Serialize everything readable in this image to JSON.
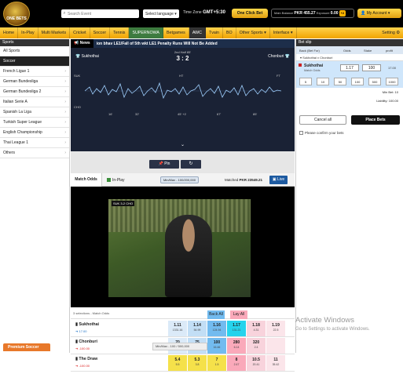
{
  "brand": {
    "logo_text": "ONE BETS"
  },
  "search": {
    "placeholder": "Search Event"
  },
  "language": {
    "label": "Select language ▾"
  },
  "timezone": {
    "label": "Time Zone",
    "value": "GMT+5:30"
  },
  "one_click": {
    "label": "One Click Bet"
  },
  "balance": {
    "main_label": "Main Balance",
    "main_value": "PKR 455.27",
    "exposure_label": "Exposure",
    "exposure_value": "0.00",
    "plus": "+2"
  },
  "account": {
    "label": "My Account ▾"
  },
  "nav": {
    "items": [
      "Home",
      "In-Play",
      "Multi Markets",
      "Cricket",
      "Soccer",
      "Tennis",
      "SUPERNOWA",
      "Betgames",
      "AWC",
      "Tvain",
      "BO",
      "Other Sports ▾",
      "Interface ▾"
    ],
    "setting": "Setting ⚙"
  },
  "sidebar": {
    "header": "Sports",
    "all": "All Sports",
    "current": "Soccer",
    "items": [
      "French Ligue 1",
      "German Bundesliga",
      "German Bundesliga 2",
      "Italian Serie A",
      "Spanish La Liga",
      "Turkish Super League",
      "English Championship",
      "Thai League 1",
      "Others"
    ]
  },
  "news": {
    "tag": "News",
    "text": "ion bhav LE1/Fall of 5th wkt LE1 Penalty Runs Will Not Be Added"
  },
  "scoreboard": {
    "home": "Sukhothai",
    "away": "Chonburi",
    "date": "2nd Half 85'",
    "score": "3 : 2",
    "home_short": "SUK",
    "away_short": "CHO",
    "ht": "HT",
    "ft": "FT",
    "minute_labels": [
      "16'",
      "32'",
      "45' +2",
      "67'",
      "85'"
    ]
  },
  "controls": {
    "pin": "Pin",
    "refresh": "↻"
  },
  "market_bar": {
    "tab": "Match Odds",
    "inplay": "In-Play",
    "minmax": "Min/Max - 100/200,000",
    "matched_label": "Matched",
    "matched_value": "PKR 23549.21",
    "live": "Live"
  },
  "video": {
    "overlay": "SUK 3-2 CHO"
  },
  "odds": {
    "selections_label": "3 selections - Match Odds",
    "back_all": "Back All",
    "lay_all": "Lay All",
    "rows": [
      {
        "name": "Sukhothai",
        "sub": "17.00",
        "sub_red": false,
        "back": [
          {
            "p": "1.11",
            "s": "1331.16"
          },
          {
            "p": "1.14",
            "s": "54.99"
          },
          {
            "p": "1.16",
            "s": "124.94"
          }
        ],
        "lay": [
          {
            "p": "1.17",
            "s": "131.21"
          },
          {
            "p": "1.18",
            "s": "4.31"
          },
          {
            "p": "1.19",
            "s": "22.5"
          }
        ]
      },
      {
        "name": "Chonburi",
        "sub": "-100.00",
        "sub_red": true,
        "back": [
          {
            "p": "70",
            "s": "2.1"
          },
          {
            "p": "75",
            "s": "1.0"
          },
          {
            "p": "100",
            "s": "16.46"
          }
        ],
        "lay": [
          {
            "p": "280",
            "s": "6.14"
          },
          {
            "p": "320",
            "s": "2.4"
          },
          {
            "p": "",
            "s": ""
          }
        ]
      },
      {
        "name": "The Draw",
        "sub": "-100.00",
        "sub_red": true,
        "back": [
          {
            "p": "5.4",
            "s": "5.5"
          },
          {
            "p": "5.3",
            "s": "3.8"
          },
          {
            "p": "7",
            "s": "1.5"
          }
        ],
        "lay": [
          {
            "p": "8",
            "s": "2.47"
          },
          {
            "p": "10.5",
            "s": "20.41"
          },
          {
            "p": "11",
            "s": "35.42"
          }
        ]
      }
    ]
  },
  "promo": {
    "label": "Premium Soccer"
  },
  "pager": {
    "label": "Min/Max - 100 / 500,000"
  },
  "betslip": {
    "header": "Bet slip",
    "cols": [
      "Back (Bet For)",
      "Odds",
      "Stake",
      "profit"
    ],
    "match": "Sukhothai v Chonburi",
    "selection": "Sukhothai",
    "market": "Match Odds",
    "odds": "1.17",
    "stake": "100",
    "profit": "17.00",
    "quick_stakes": [
      "5",
      "10",
      "50",
      "100",
      "500",
      "1000"
    ],
    "min_bet": "Min Bet: 10",
    "liability_label": "Liability:",
    "liability_value": "100.00",
    "cancel": "Cancel all",
    "place": "Place Bets",
    "confirm": "Please confirm your bets"
  },
  "windows_watermark": {
    "title": "Activate Windows",
    "subtitle": "Go to Settings to activate Windows."
  },
  "colors": {
    "back": "#72bbef",
    "lay": "#faa9ba",
    "nav": "#ffb400",
    "brand": "#1d2e4a"
  }
}
